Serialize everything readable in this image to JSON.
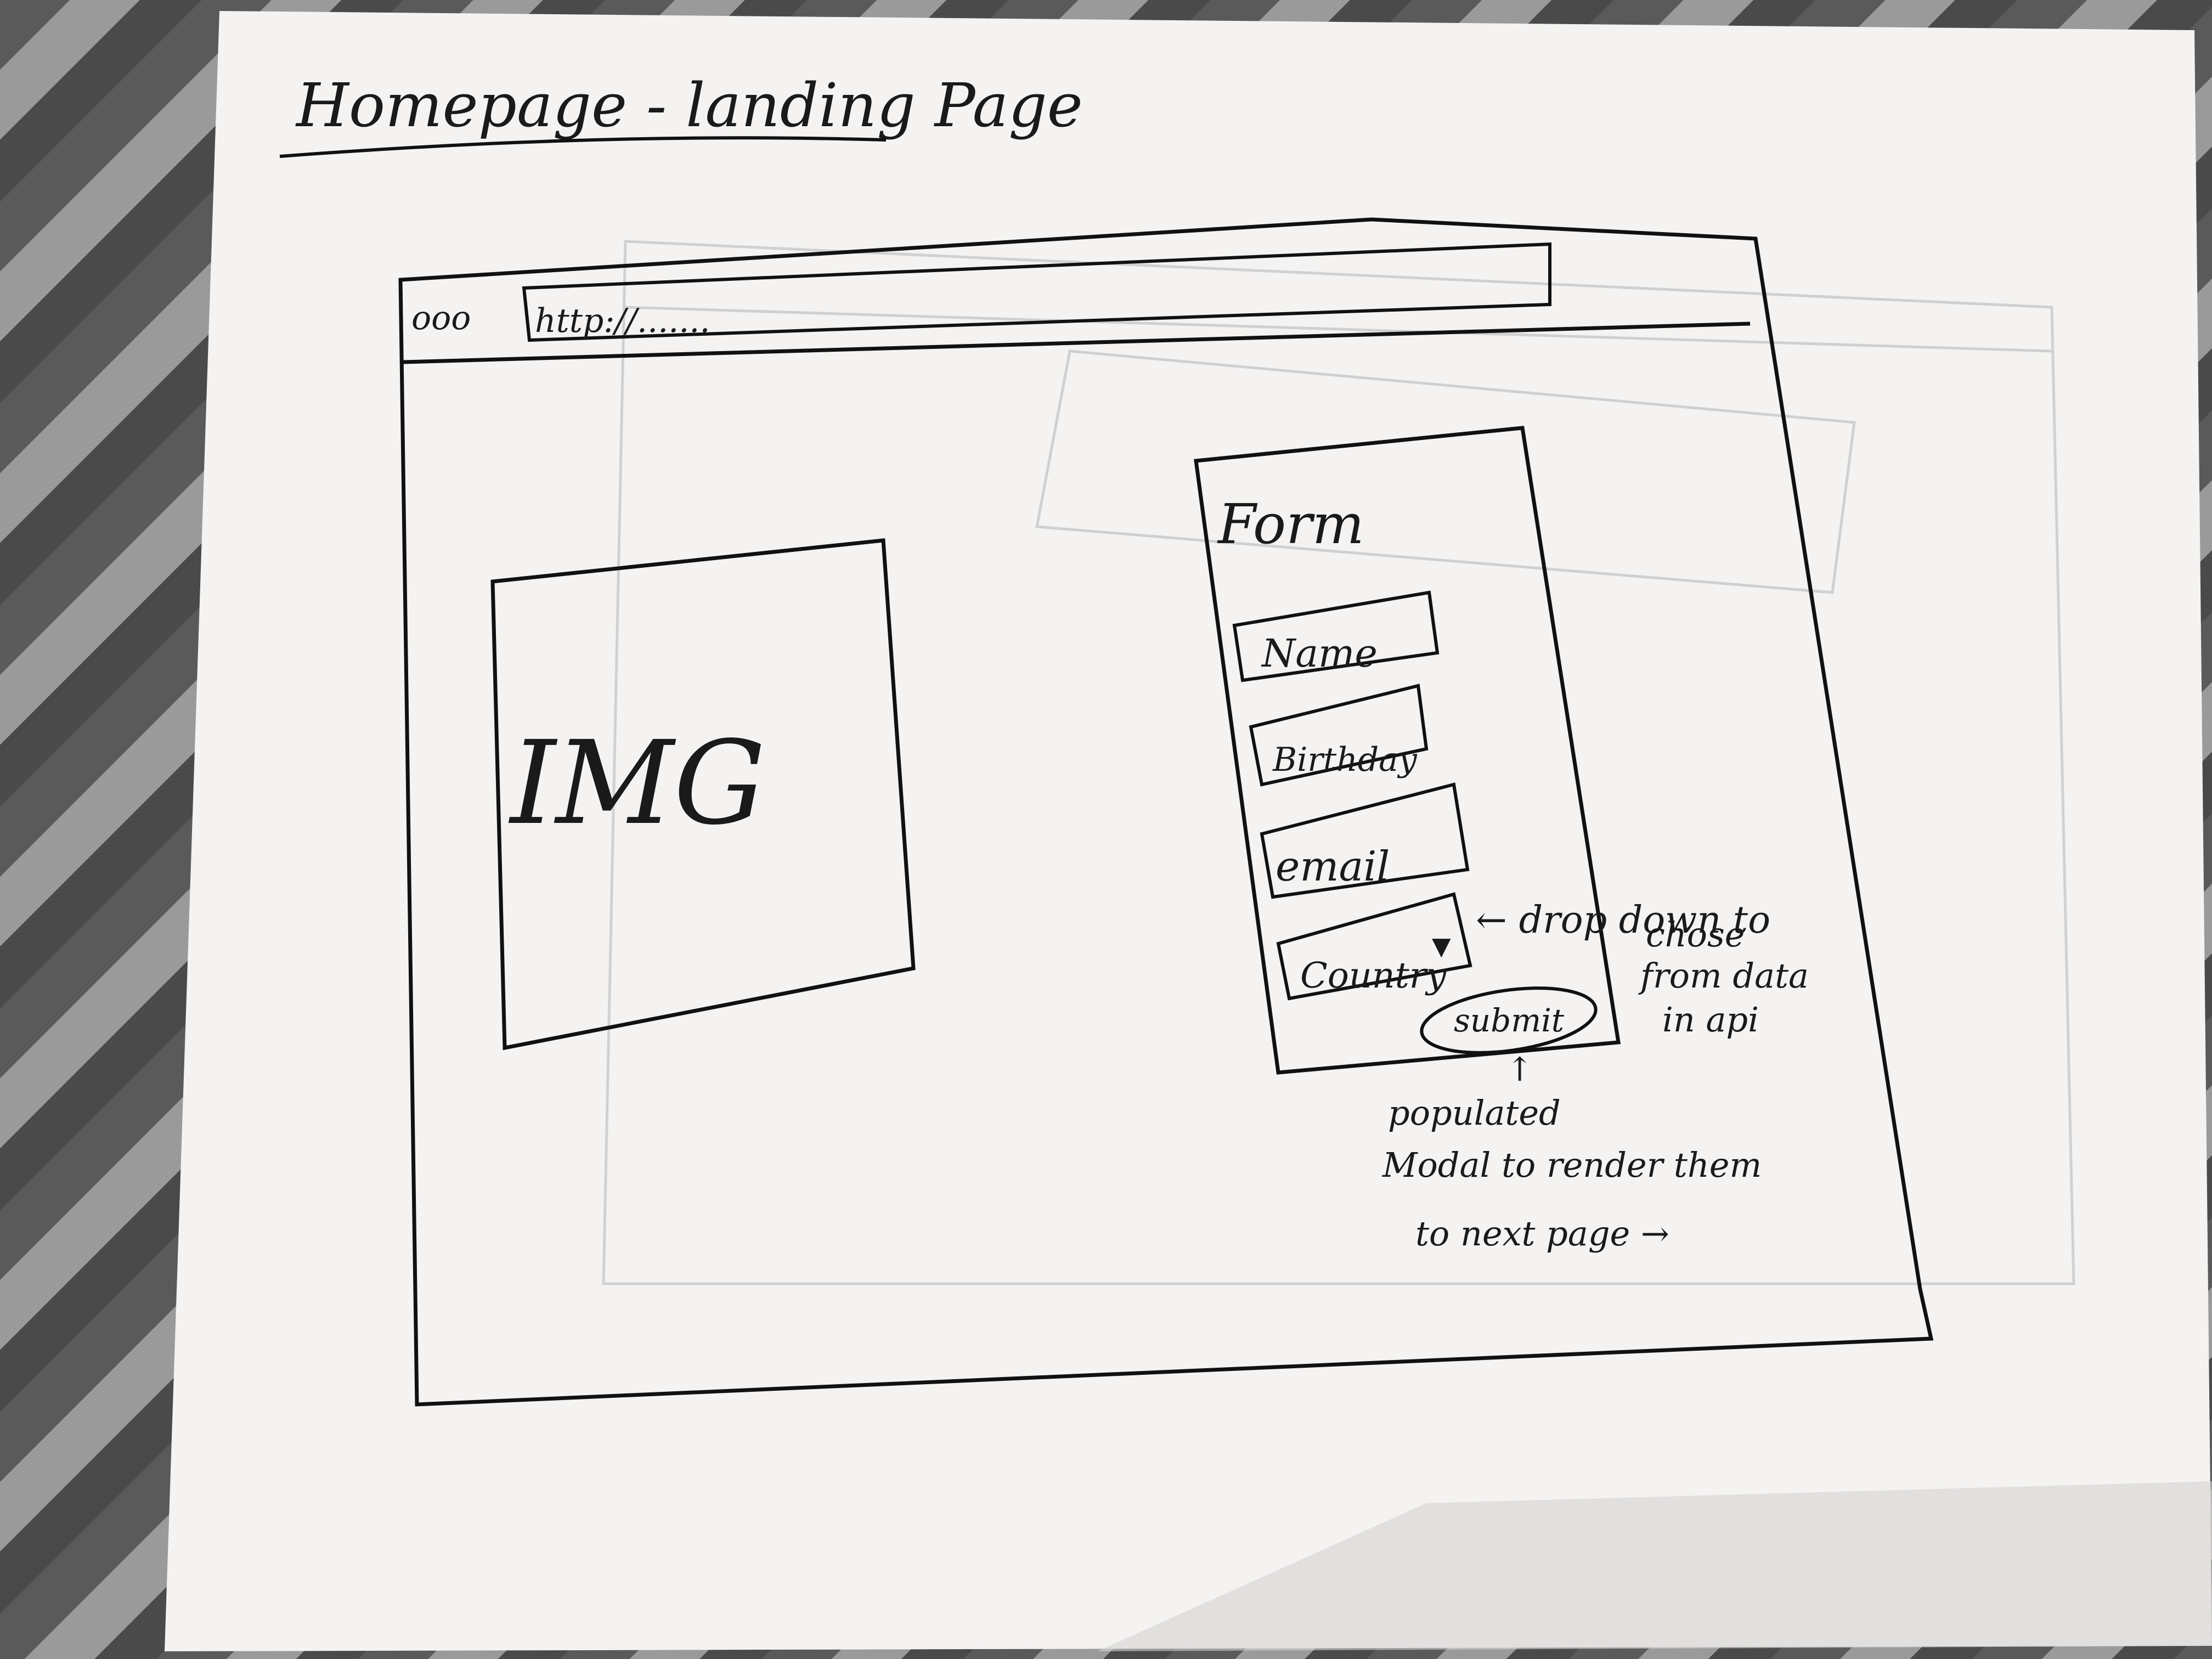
{
  "sketch": {
    "title": "Homepage - landing Page",
    "browser": {
      "window_controls": "ooo",
      "url": "http://.......",
      "image_placeholder": "IMG",
      "form": {
        "heading": "Form",
        "fields": [
          {
            "label": "Name"
          },
          {
            "label": "Birthday"
          },
          {
            "label": "email"
          },
          {
            "label": "Country",
            "dropdown_arrow": "▼"
          }
        ],
        "submit_label": "submit"
      }
    },
    "annotations": {
      "dropdown_note": [
        "← drop down to",
        "chose",
        "from data",
        "in api"
      ],
      "submit_note": [
        "↑",
        "populated",
        "Modal to render them",
        "to next page →"
      ]
    }
  }
}
